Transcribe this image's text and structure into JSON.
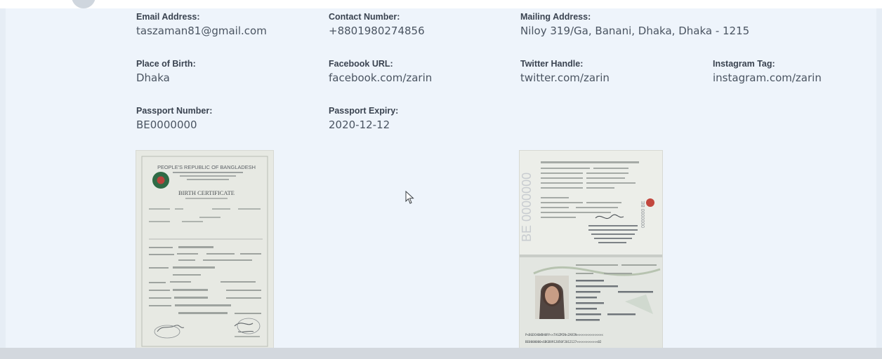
{
  "profile": {
    "email": {
      "label": "Email Address:",
      "value": "taszaman81@gmail.com"
    },
    "contact": {
      "label": "Contact Number:",
      "value": "+8801980274856"
    },
    "mailing": {
      "label": "Mailing Address:",
      "value": "Niloy 319/Ga, Banani, Dhaka, Dhaka - 1215"
    },
    "birthplace": {
      "label": "Place of Birth:",
      "value": "Dhaka"
    },
    "facebook": {
      "label": "Facebook URL:",
      "value": "facebook.com/zarin"
    },
    "twitter": {
      "label": "Twitter Handle:",
      "value": "twitter.com/zarin"
    },
    "instagram": {
      "label": "Instagram Tag:",
      "value": "instagram.com/zarin"
    },
    "passport_number": {
      "label": "Passport Number:",
      "value": "BE0000000"
    },
    "passport_expiry": {
      "label": "Passport Expiry:",
      "value": "2020-12-12"
    }
  },
  "documents": {
    "birth_certificate": {
      "country": "PEOPLE'S REPUBLIC OF BANGLADESH",
      "title": "BIRTH CERTIFICATE"
    },
    "passport": {
      "mrz_line1": "P<BGDCHOWDHURY<<TASZMIN<ZARIN<<<<<<<<<<<<<<<",
      "mrz_line2": "BE0000000<6BGD8912050F2012127<<<<<<<<<<<<02"
    }
  },
  "colors": {
    "page_bg": "#eef4fb",
    "label": "#3a4350",
    "value": "#4a5461"
  }
}
